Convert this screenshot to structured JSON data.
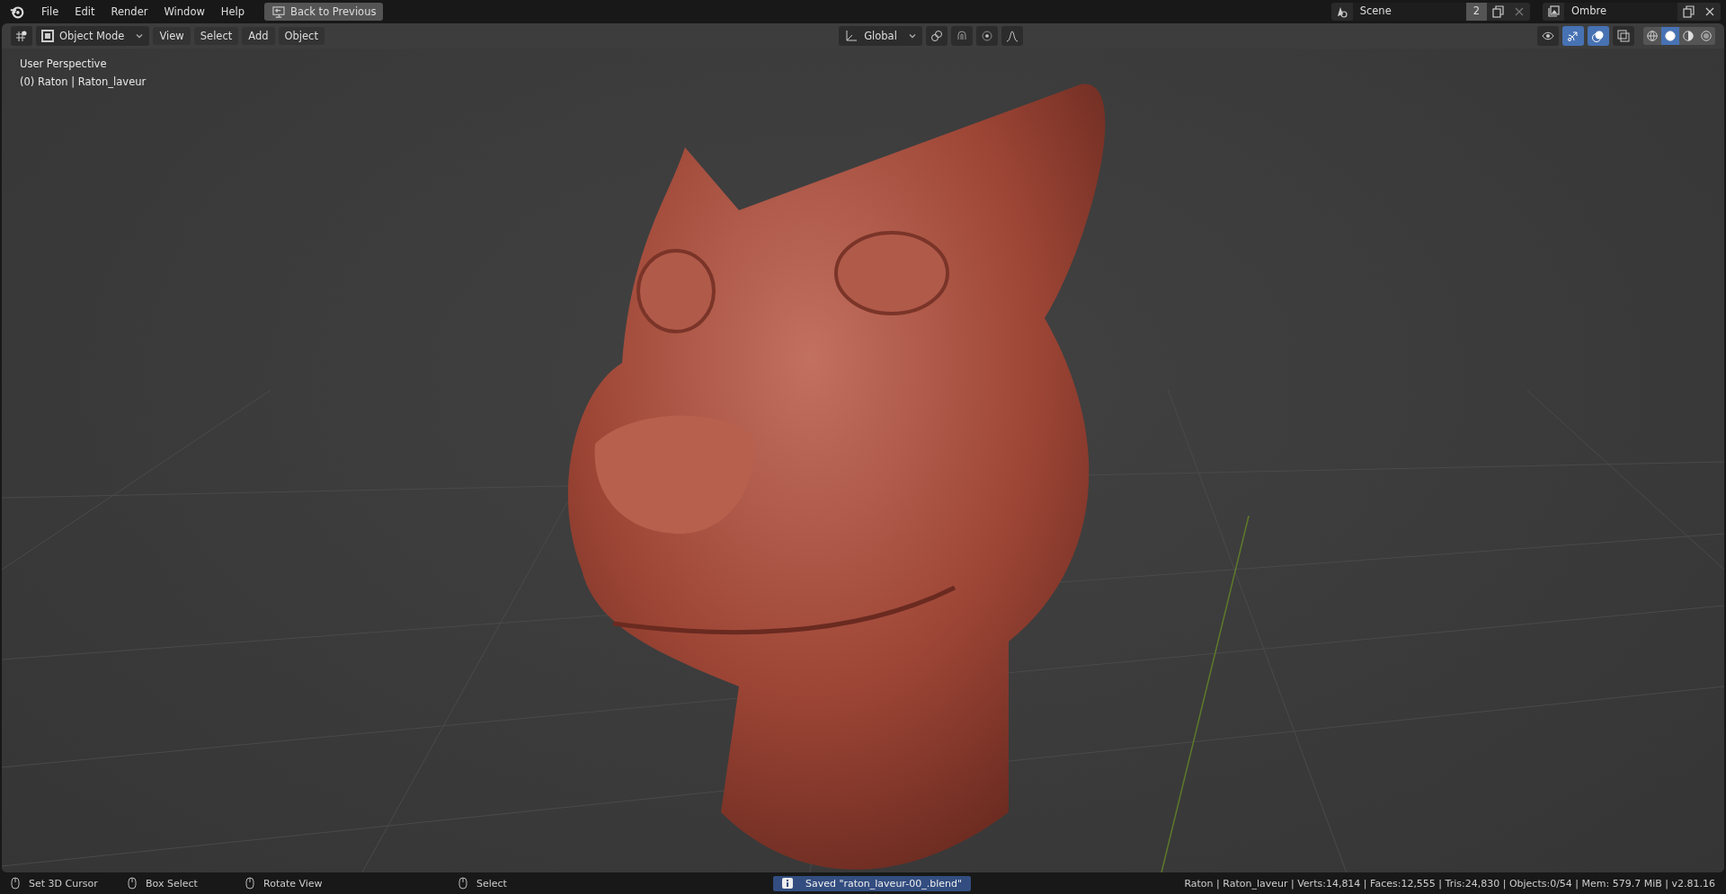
{
  "top_bar": {
    "menu": [
      "File",
      "Edit",
      "Render",
      "Window",
      "Help"
    ],
    "back_button": "Back to Previous",
    "scene": {
      "name": "Scene",
      "users": "2"
    },
    "view_layer": {
      "name": "Ombre"
    }
  },
  "header": {
    "mode": "Object Mode",
    "menus": [
      "View",
      "Select",
      "Add",
      "Object"
    ],
    "orientation": "Global",
    "toggles": [
      {
        "kind": "snap",
        "on": false
      },
      {
        "kind": "proportional",
        "on": false
      }
    ],
    "overlays": [
      {
        "kind": "gizmo",
        "on": true
      },
      {
        "kind": "overlay",
        "on": true
      },
      {
        "kind": "xray",
        "on": false
      }
    ],
    "shading": [
      {
        "kind": "wireframe",
        "selected": false
      },
      {
        "kind": "solid",
        "selected": true
      },
      {
        "kind": "material",
        "selected": false
      },
      {
        "kind": "rendered",
        "selected": false
      }
    ]
  },
  "viewport": {
    "view_name": "User Perspective",
    "object_info": "(0) Raton | Raton_laveur"
  },
  "status_bar": {
    "hints": [
      {
        "label": "Set 3D Cursor"
      },
      {
        "label": "Box Select"
      },
      {
        "label": "Rotate View"
      },
      {
        "label": "Select"
      }
    ],
    "message": "Saved \"raton_laveur-00_.blend\"",
    "stats": "Raton | Raton_laveur | Verts:14,814 | Faces:12,555 | Tris:24,830 | Objects:0/54 | Mem: 579.7 MiB | v2.81.16"
  }
}
